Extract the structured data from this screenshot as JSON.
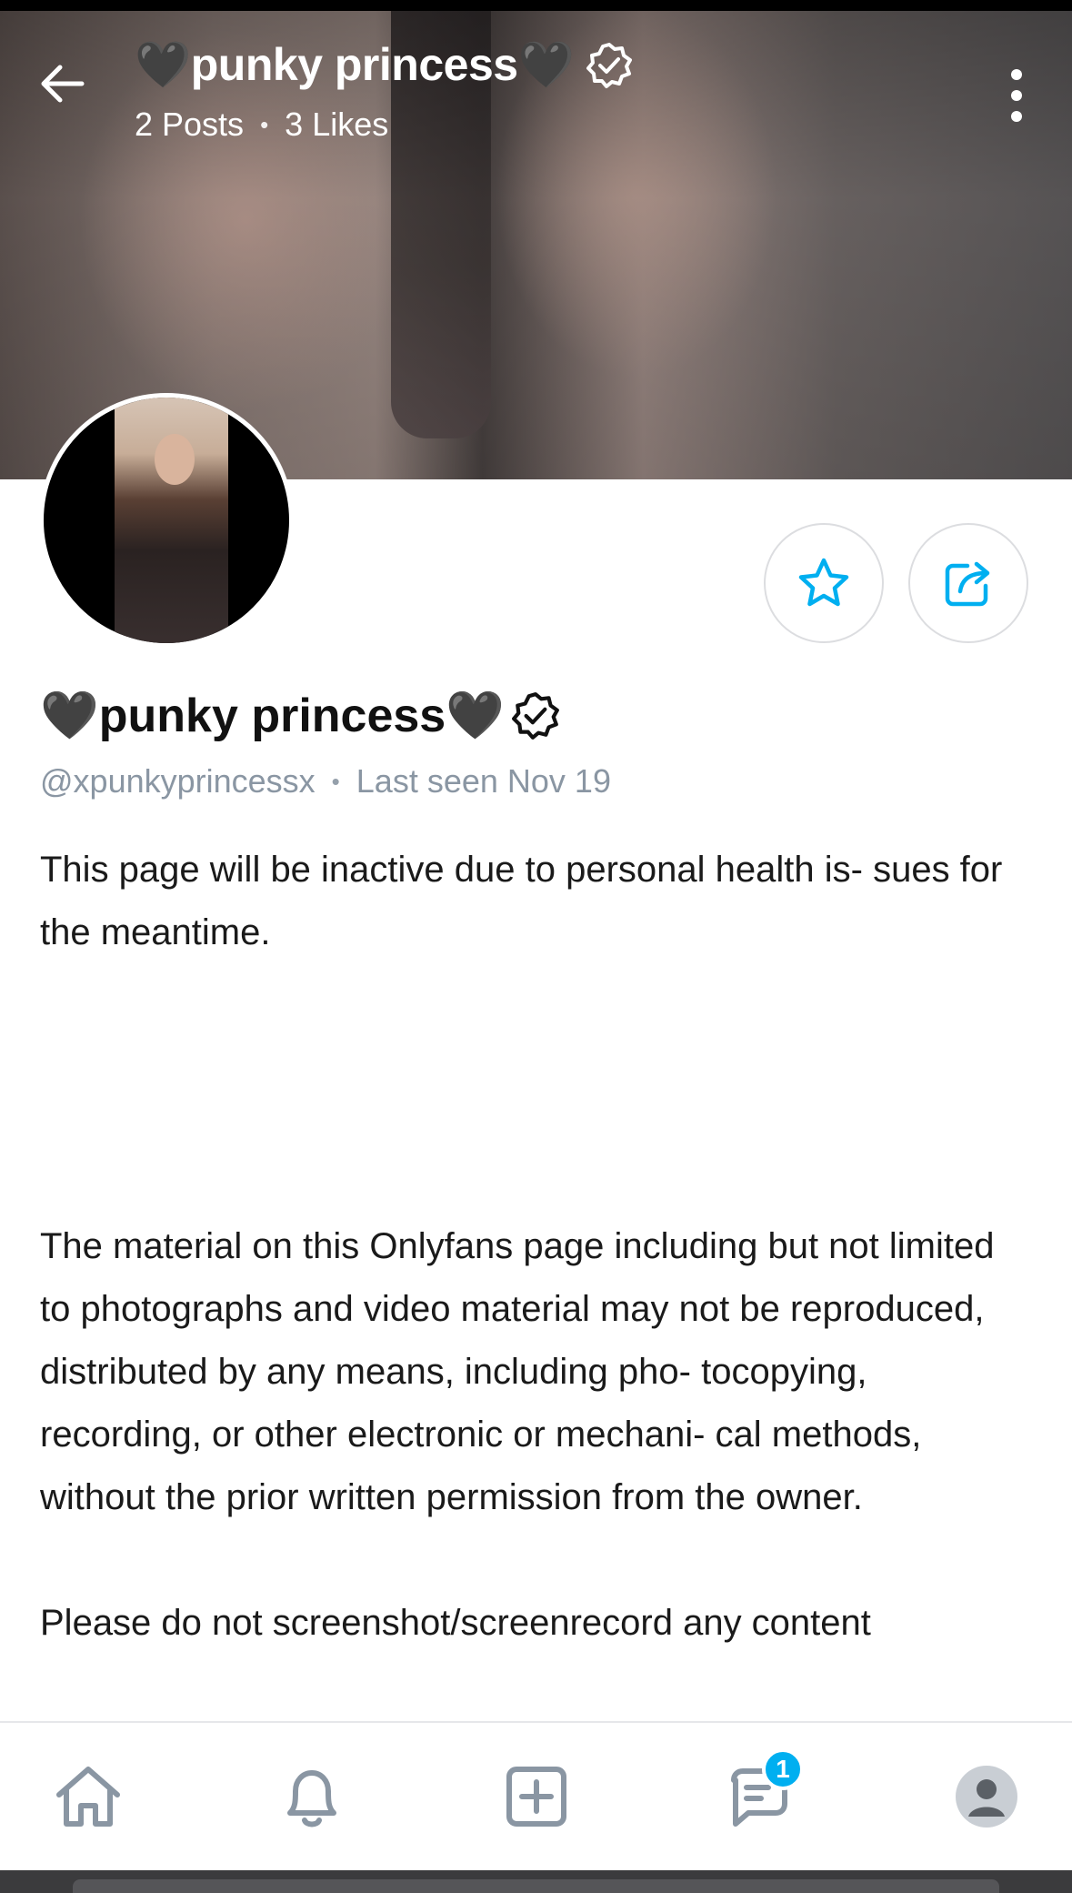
{
  "header": {
    "title": "🖤punky princess🖤",
    "posts": "2 Posts",
    "separator": "•",
    "likes": "3 Likes"
  },
  "profile": {
    "display_name": "🖤punky princess🖤",
    "handle": "@xpunkyprincessx",
    "separator": "•",
    "last_seen": "Last seen Nov 19"
  },
  "bio": {
    "paragraph_1": "This page will be inactive due to personal health is- sues for the meantime.",
    "paragraph_2": "The material on this Onlyfans page including but not limited to photographs and video material may not be reproduced, distributed by any means, including pho- tocopying, recording, or other electronic or mechani- cal methods, without the prior written permission from the owner.",
    "paragraph_3": "Please do not screenshot/screenrecord any content"
  },
  "icons": {
    "back": "arrow-left-icon",
    "more": "more-vertical-icon",
    "verified": "verified-badge-icon",
    "favorite": "star-icon",
    "share": "share-icon",
    "home": "home-icon",
    "notifications": "bell-icon",
    "add": "plus-square-icon",
    "messages": "chat-icon",
    "profile": "user-avatar-icon"
  },
  "bottom_nav": {
    "messages_badge": "1"
  },
  "colors": {
    "accent": "#00aff0",
    "muted_text": "#8a96a3",
    "icon_gray": "#8a96a3"
  }
}
